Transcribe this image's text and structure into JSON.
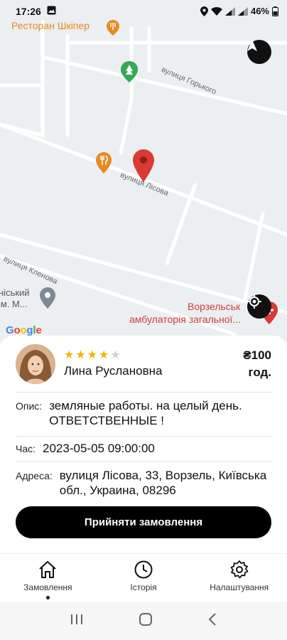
{
  "status_bar": {
    "time": "17:26",
    "battery": "46%"
  },
  "map": {
    "streets": {
      "gorkogo": "вулиця Горького",
      "lisova": "вулиця Лісова",
      "klenova": "вулиця Кленова"
    },
    "pois": {
      "restaurant": "Ресторан Шкіпер",
      "clinic_line1": "Ворзельськ",
      "clinic_line2": "амбулаторія загальної...",
      "left_line1": "нiський",
      "left_line2": "iм. М..."
    },
    "google": [
      "G",
      "o",
      "o",
      "g",
      "l",
      "e"
    ]
  },
  "order": {
    "user_name": "Лина Руслановна",
    "rating": 4,
    "rating_max": 5,
    "price_line1": "₴100",
    "price_line2": "год.",
    "description_label": "Опис:",
    "description": "земляные работы. на целый день. ОТВЕТСТВЕННЫЕ !",
    "time_label": "Час:",
    "time": "2023-05-05 09:00:00",
    "address_label": "Адреса:",
    "address": "вулиця Лісова, 33, Ворзель, Київська обл., Украина, 08296",
    "accept_button": "Прийняти замовлення"
  },
  "nav": {
    "items": [
      {
        "label": "Замовлення",
        "icon": "home-icon",
        "active": true
      },
      {
        "label": "Історія",
        "icon": "clock-icon",
        "active": false
      },
      {
        "label": "Налаштування",
        "icon": "gear-icon",
        "active": false
      }
    ]
  },
  "colors": {
    "accent": "#000000",
    "star": "#f2b600",
    "pin": "#d93a33"
  }
}
